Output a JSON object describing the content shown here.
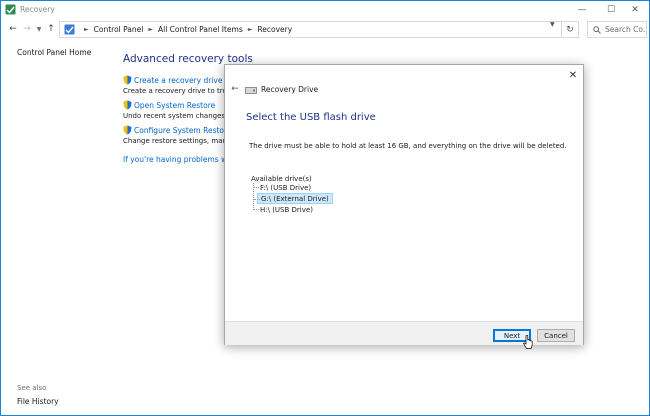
{
  "window": {
    "title": "Recovery"
  },
  "address": {
    "breadcrumbs": [
      "Control Panel",
      "All Control Panel Items",
      "Recovery"
    ],
    "search_placeholder": "Search Co..."
  },
  "left_pane": {
    "home_link": "Control Panel Home",
    "see_also_label": "See also",
    "file_history_link": "File History"
  },
  "main": {
    "heading": "Advanced recovery tools",
    "tools": [
      {
        "link": "Create a recovery drive",
        "desc": "Create a recovery drive to troublesh"
      },
      {
        "link": "Open System Restore",
        "desc": "Undo recent system changes, but le"
      },
      {
        "link": "Configure System Restore",
        "desc": "Change restore settings, manage di"
      }
    ],
    "problems_link": "If you're having problems with your"
  },
  "dialog": {
    "title": "Recovery Drive",
    "heading": "Select the USB flash drive",
    "description": "The drive must be able to hold at least 16 GB, and everything on the drive will be deleted.",
    "available_label": "Available drive(s)",
    "drives": [
      "F:\\ (USB Drive)",
      "G:\\ (External Drive)",
      "H:\\ (USB Drive)"
    ],
    "selected_drive_index": 1,
    "next_label": "Next",
    "cancel_label": "Cancel"
  },
  "colors": {
    "accent": "#0078d7",
    "heading": "#1e3287",
    "link": "#0066cc",
    "selection": "#cce8ff"
  },
  "icons": [
    "recovery-icon",
    "minimize-icon",
    "maximize-icon",
    "close-icon",
    "back-arrow-icon",
    "forward-arrow-icon",
    "up-arrow-icon",
    "refresh-icon",
    "search-icon",
    "shield-icon",
    "usb-drive-icon",
    "mouse-cursor-icon"
  ]
}
